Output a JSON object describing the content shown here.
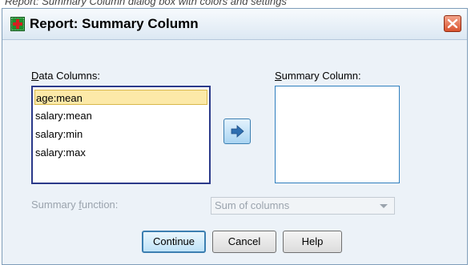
{
  "top_caption": "Report: Summary Column dialog box with colors and settings",
  "dialog": {
    "title": "Report: Summary Column"
  },
  "data_columns": {
    "label_mnemonic": "D",
    "label_rest": "ata Columns:",
    "items": [
      "age:mean",
      "salary:mean",
      "salary:min",
      "salary:max"
    ],
    "selected_index": 0
  },
  "summary_column": {
    "label_mnemonic": "S",
    "label_rest": "ummary Column:",
    "items": []
  },
  "move_button": {
    "icon": "arrow-right-icon"
  },
  "summary_function": {
    "label_before": "Summary ",
    "label_mnemonic": "f",
    "label_after": "unction:",
    "selected": "Sum of columns",
    "enabled": false
  },
  "buttons": {
    "continue": "Continue",
    "cancel": "Cancel",
    "help": "Help"
  },
  "colors": {
    "accent": "#3c7fb1",
    "selection": "#fce9a8",
    "close_button": "#d9532f",
    "dialog_background": "#ecf2f8"
  }
}
